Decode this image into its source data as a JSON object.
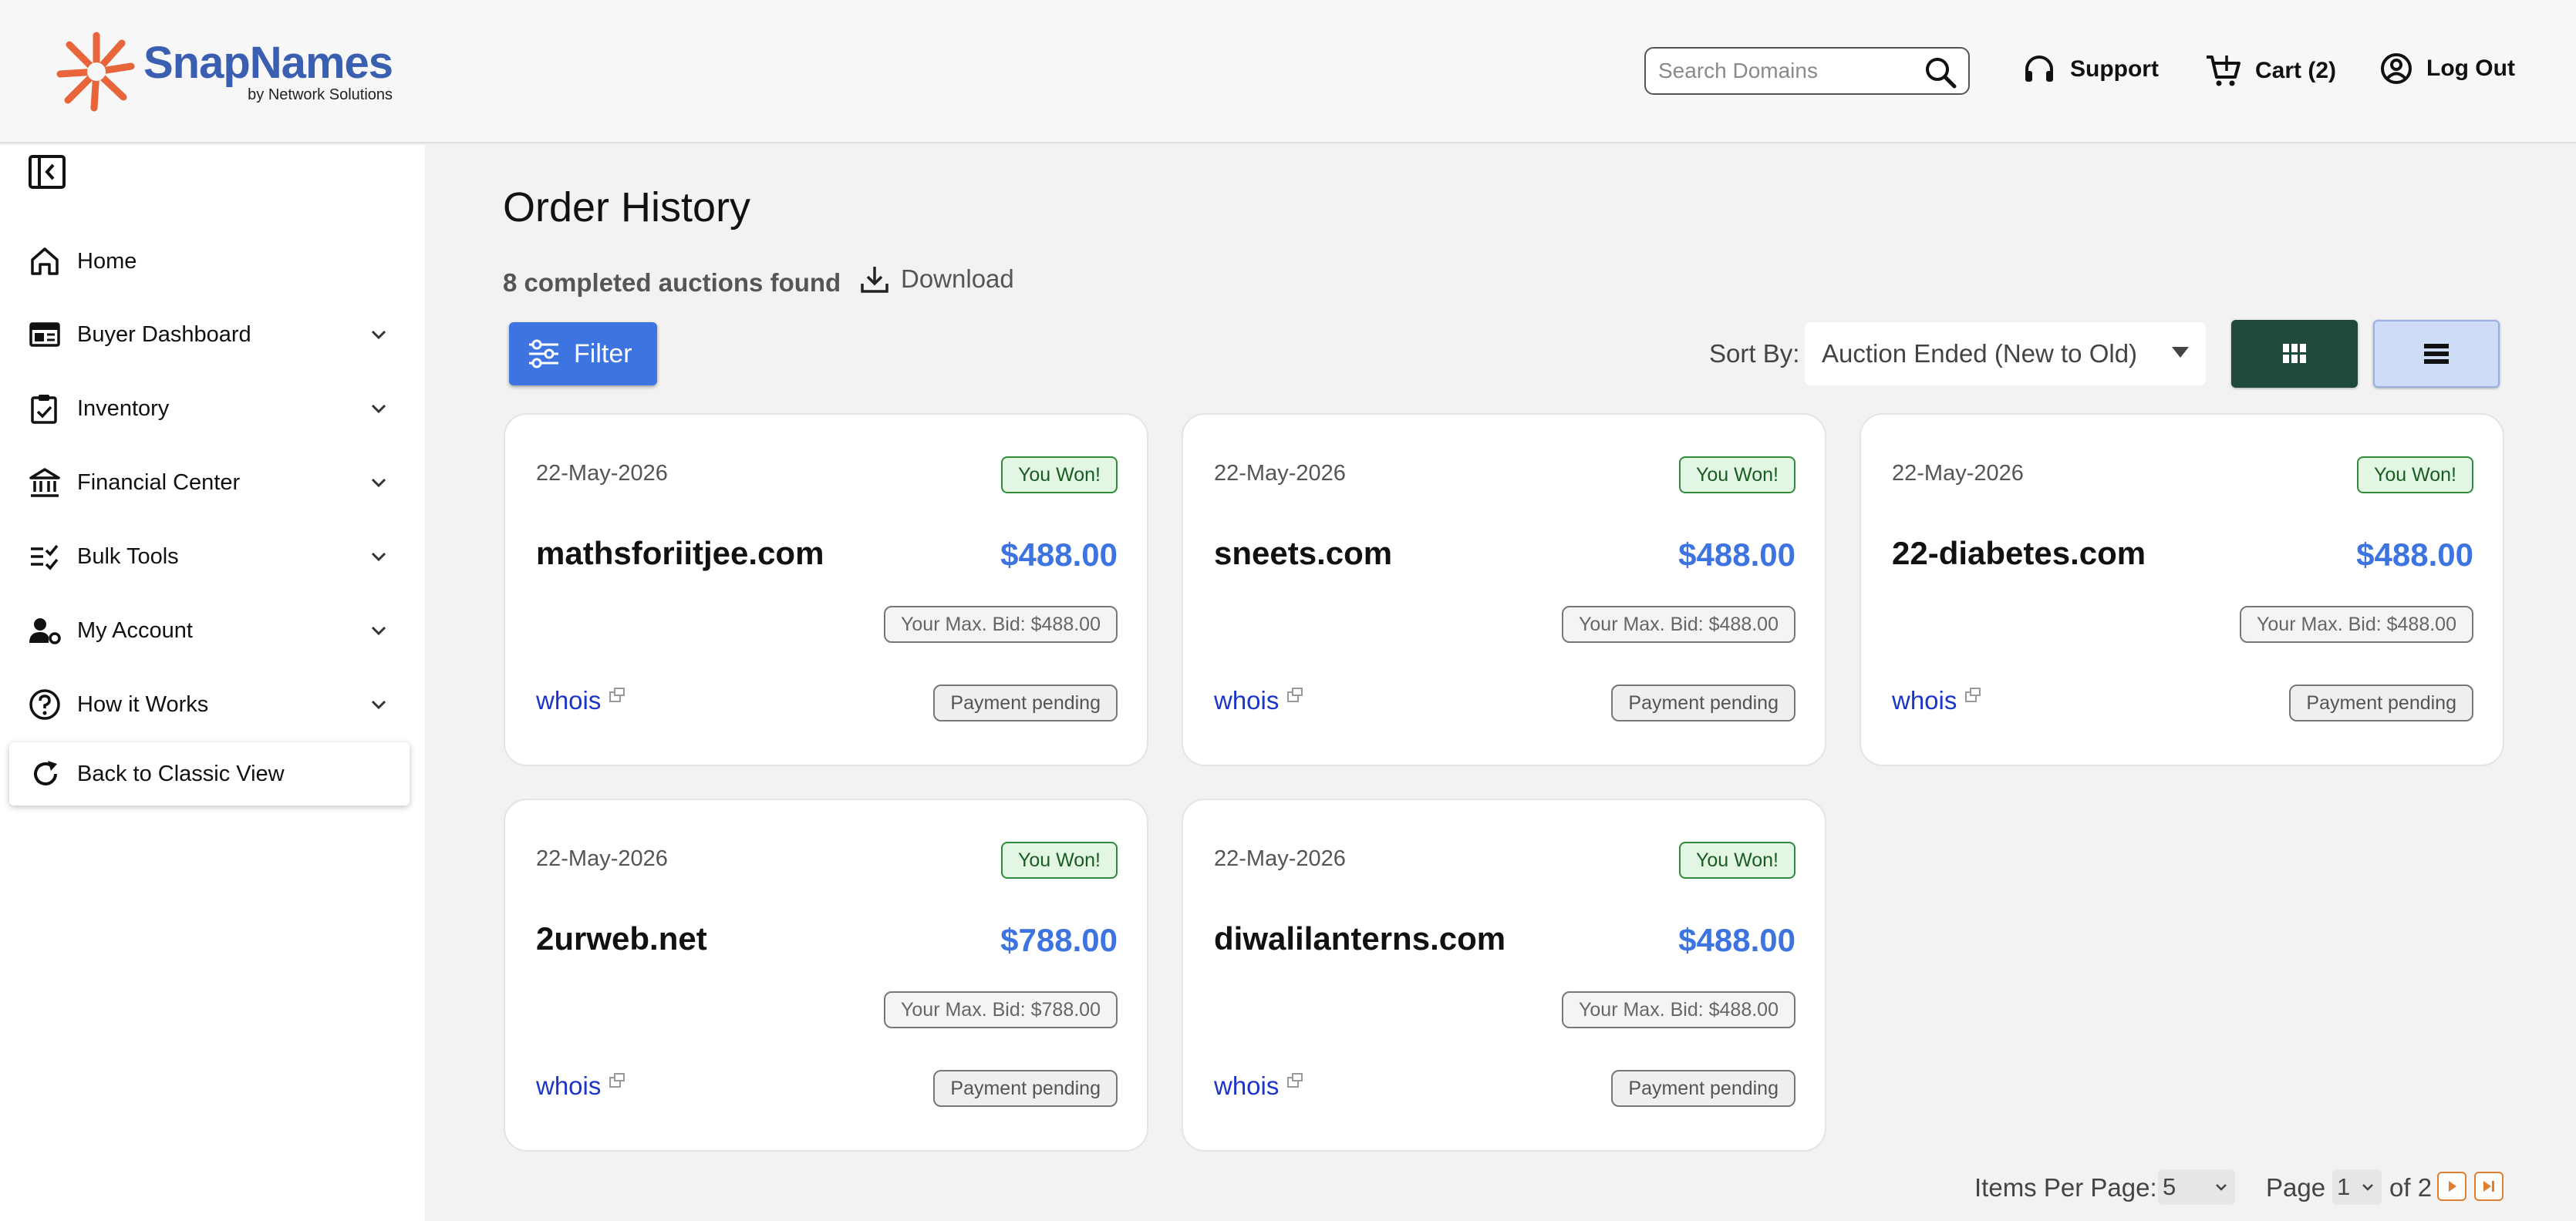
{
  "header": {
    "logo_name": "SnapNames",
    "logo_sub": "by Network Solutions",
    "search_placeholder": "Search Domains",
    "support_label": "Support",
    "cart_label": "Cart (2)",
    "logout_label": "Log Out"
  },
  "sidebar": {
    "items": [
      {
        "label": "Home",
        "icon": "home-icon"
      },
      {
        "label": "Buyer Dashboard",
        "icon": "dashboard-icon"
      },
      {
        "label": "Inventory",
        "icon": "clipboard-icon"
      },
      {
        "label": "Financial Center",
        "icon": "bank-icon"
      },
      {
        "label": "Bulk Tools",
        "icon": "checklist-icon"
      },
      {
        "label": "My Account",
        "icon": "user-gear-icon"
      },
      {
        "label": "How it Works",
        "icon": "help-icon"
      }
    ],
    "classic_label": "Back to Classic View"
  },
  "main": {
    "title": "Order History",
    "found_text": "8 completed auctions found",
    "download_label": "Download",
    "filter_label": "Filter",
    "sort_label": "Sort By:",
    "sort_value": "Auction Ended (New to Old)"
  },
  "cards": [
    {
      "date": "22-May-2026",
      "status": "You Won!",
      "domain": "mathsforiitjee.com",
      "price": "$488.00",
      "max_bid": "Your Max. Bid: $488.00",
      "whois": "whois",
      "payment": "Payment pending"
    },
    {
      "date": "22-May-2026",
      "status": "You Won!",
      "domain": "sneets.com",
      "price": "$488.00",
      "max_bid": "Your Max. Bid: $488.00",
      "whois": "whois",
      "payment": "Payment pending"
    },
    {
      "date": "22-May-2026",
      "status": "You Won!",
      "domain": "22-diabetes.com",
      "price": "$488.00",
      "max_bid": "Your Max. Bid: $488.00",
      "whois": "whois",
      "payment": "Payment pending"
    },
    {
      "date": "22-May-2026",
      "status": "You Won!",
      "domain": "2urweb.net",
      "price": "$788.00",
      "max_bid": "Your Max. Bid: $788.00",
      "whois": "whois",
      "payment": "Payment pending"
    },
    {
      "date": "22-May-2026",
      "status": "You Won!",
      "domain": "diwalilanterns.com",
      "price": "$488.00",
      "max_bid": "Your Max. Bid: $488.00",
      "whois": "whois",
      "payment": "Payment pending"
    }
  ],
  "pagination": {
    "items_per_page_label": "Items Per Page:",
    "items_per_page_value": "5",
    "page_label": "Page",
    "page_value": "1",
    "of_label": "of 2"
  },
  "colors": {
    "accent": "#3d74e0",
    "grid_view_active": "#1f4a3a",
    "won_green": "#2e8b3a",
    "logo_orange": "#e8643a",
    "logo_blue": "#3a5fb0"
  }
}
